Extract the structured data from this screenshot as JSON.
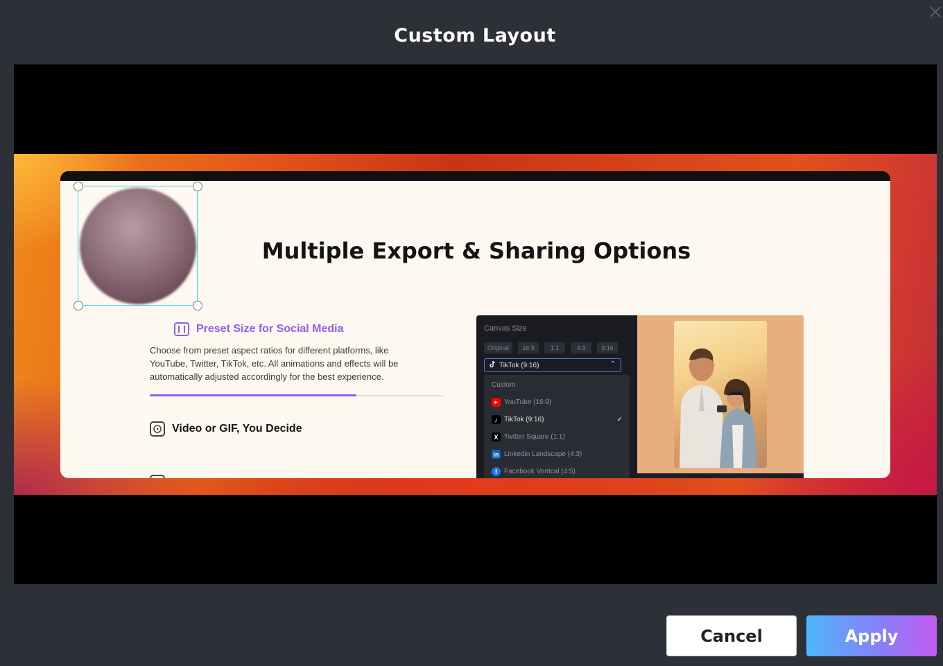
{
  "dialog": {
    "title": "Custom Layout",
    "cancel_label": "Cancel",
    "apply_label": "Apply"
  },
  "slide": {
    "heading": "Multiple Export & Sharing Options",
    "feature1_title": "Preset Size for Social Media",
    "feature1_desc": "Choose from preset aspect ratios for different platforms, like YouTube, Twitter, TikTok, etc. All animations and effects will be automatically adjusted accordingly for the best experience.",
    "feature1_progress_pct": 70,
    "feature2_title": "Video or GIF, You Decide"
  },
  "editor": {
    "canvas_label": "Canvas Size",
    "ratios": [
      "Original",
      "16:9",
      "1:1",
      "4:3",
      "9:16"
    ],
    "selected": "TikTok (9:16)",
    "menu_items": [
      {
        "label": "Custom",
        "icon": "none",
        "active": false
      },
      {
        "label": "YouTube (16:9)",
        "icon": "youtube-icon",
        "color": "#ff0000",
        "active": false
      },
      {
        "label": "TikTok (9:16)",
        "icon": "tiktok-icon",
        "color": "#000000",
        "active": true
      },
      {
        "label": "Twitter Square (1:1)",
        "icon": "x-icon",
        "color": "#000000",
        "active": false
      },
      {
        "label": "Linkedin Landscape (4:3)",
        "icon": "linkedin-icon",
        "color": "#0a66c2",
        "active": false
      },
      {
        "label": "Facebook Vertical (4:5)",
        "icon": "facebook-icon",
        "color": "#1877f2",
        "active": false
      }
    ]
  }
}
